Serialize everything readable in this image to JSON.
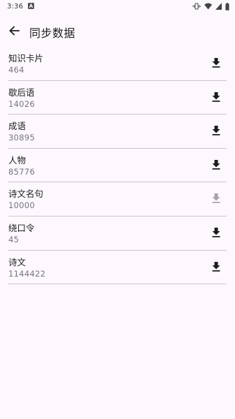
{
  "status_bar": {
    "time": "3:36",
    "icons": [
      "notification-a-icon",
      "vibrate-icon",
      "wifi-icon",
      "signal-icon",
      "battery-icon"
    ]
  },
  "app_bar": {
    "back_icon": "arrow-back-icon",
    "title": "同步数据"
  },
  "items": [
    {
      "name": "知识卡片",
      "count": "464",
      "enabled": true
    },
    {
      "name": "歇后语",
      "count": "14026",
      "enabled": true
    },
    {
      "name": "成语",
      "count": "30895",
      "enabled": true
    },
    {
      "name": "人物",
      "count": "85776",
      "enabled": true
    },
    {
      "name": "诗文名句",
      "count": "10000",
      "enabled": false
    },
    {
      "name": "绕口令",
      "count": "45",
      "enabled": true
    },
    {
      "name": "诗文",
      "count": "1144422",
      "enabled": true
    }
  ],
  "colors": {
    "background": "#fdf8fd",
    "text_primary": "#1d1b20",
    "text_secondary": "#79747e",
    "divider": "#c9c5ca"
  }
}
